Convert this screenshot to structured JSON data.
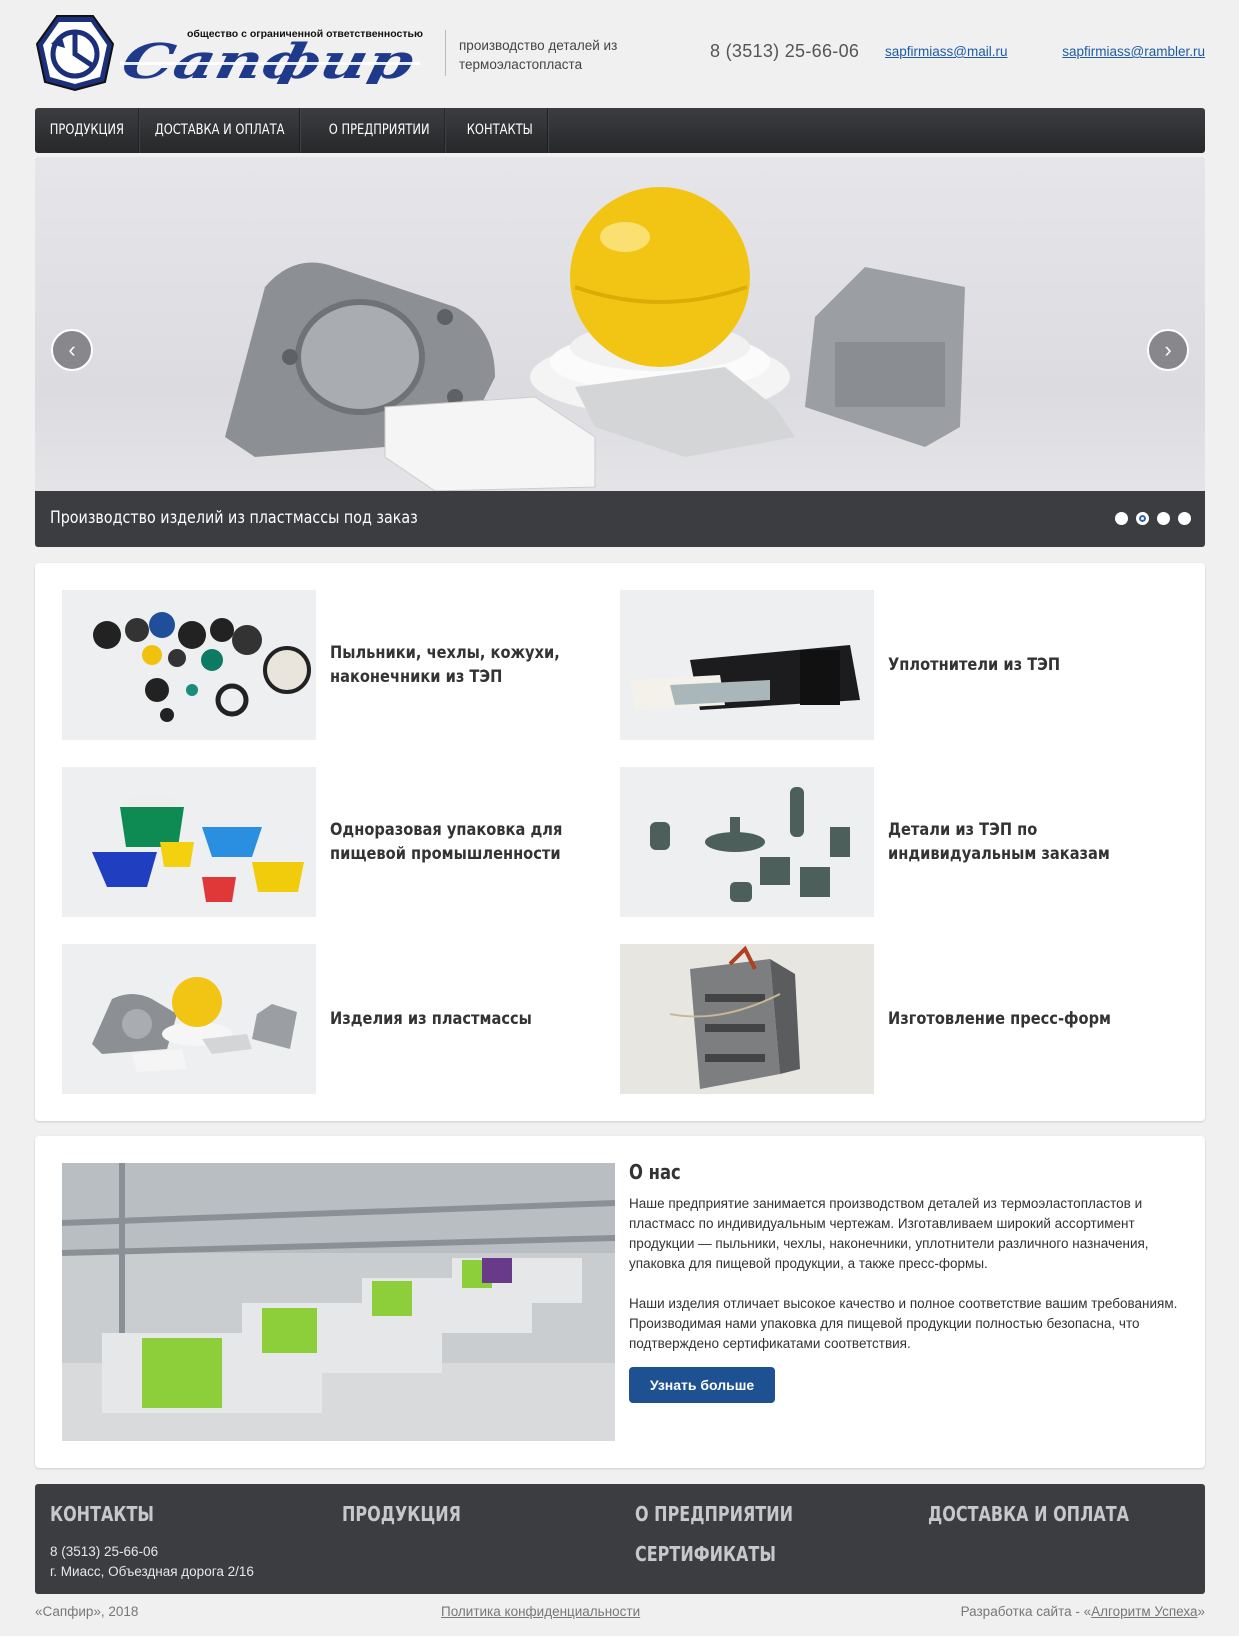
{
  "header": {
    "logo_subtitle": "общество с ограниченной ответственностью",
    "logo_word": "Сапфир",
    "tagline": "производство деталей из термоэластопласта",
    "phone": "8 (3513) 25-66-06",
    "email1": "sapfirmiass@mail.ru",
    "email2": "sapfirmiass@rambler.ru"
  },
  "nav": {
    "items": [
      "ПРОДУКЦИЯ",
      "ДОСТАВКА И ОПЛАТА",
      "О ПРЕДПРИЯТИИ",
      "КОНТАКТЫ"
    ]
  },
  "slider": {
    "caption": "Производство изделий из пластмассы под заказ",
    "prev": "‹",
    "next": "›",
    "dots": 4,
    "active_dot": 2
  },
  "products": [
    {
      "title": "Пыльники, чехлы, кожухи, наконечники из ТЭП",
      "image": "rubber-boots-icon"
    },
    {
      "title": "Уплотнители из ТЭП",
      "image": "seal-profiles-icon"
    },
    {
      "title": "Одноразовая упаковка для пищевой промышленности",
      "image": "food-packaging-icon"
    },
    {
      "title": "Детали из ТЭП по индивидуальным заказам",
      "image": "custom-parts-icon"
    },
    {
      "title": "Изделия из пластмассы",
      "image": "plastic-products-icon"
    },
    {
      "title": "Изготовление пресс-форм",
      "image": "press-mold-icon"
    }
  ],
  "about": {
    "title": "О нас",
    "p1": "Наше предприятие занимается производством деталей из термоэластопластов и пластмасс по индивидуальным чертежам. Изготавливаем широкий ассортимент продукции — пыльники, чехлы, наконечники, уплотнители различного назначения, упаковка для пищевой продукции, а также пресс-формы.",
    "p2": "Наши изделия отличает высокое качество и полное соответствие вашим требованиям. Производимая нами упаковка для пищевой продукции полностью безопасна, что подтверждено сертификатами соответствия.",
    "button": "Узнать больше"
  },
  "footer": {
    "contacts_title": "КОНТАКТЫ",
    "phone": "8 (3513) 25-66-06",
    "address": "г. Миасс, Объездная дорога 2/16",
    "products_title": "ПРОДУКЦИЯ",
    "about_title": "О ПРЕДПРИЯТИИ",
    "certs_title": "СЕРТИФИКАТЫ",
    "delivery_title": "ДОСТАВКА И ОПЛАТА"
  },
  "bottom": {
    "copyright": "«Сапфир», 2018",
    "policy": "Политика конфиденциальности",
    "dev_prefix": "Разработка сайта - «",
    "dev_link": "Алгоритм Успеха",
    "dev_suffix": "»"
  },
  "colors": {
    "brand_blue": "#1f3a8a",
    "nav_dark": "#2c2e31",
    "button_blue": "#1d5192",
    "link_blue": "#1f5aa6"
  }
}
